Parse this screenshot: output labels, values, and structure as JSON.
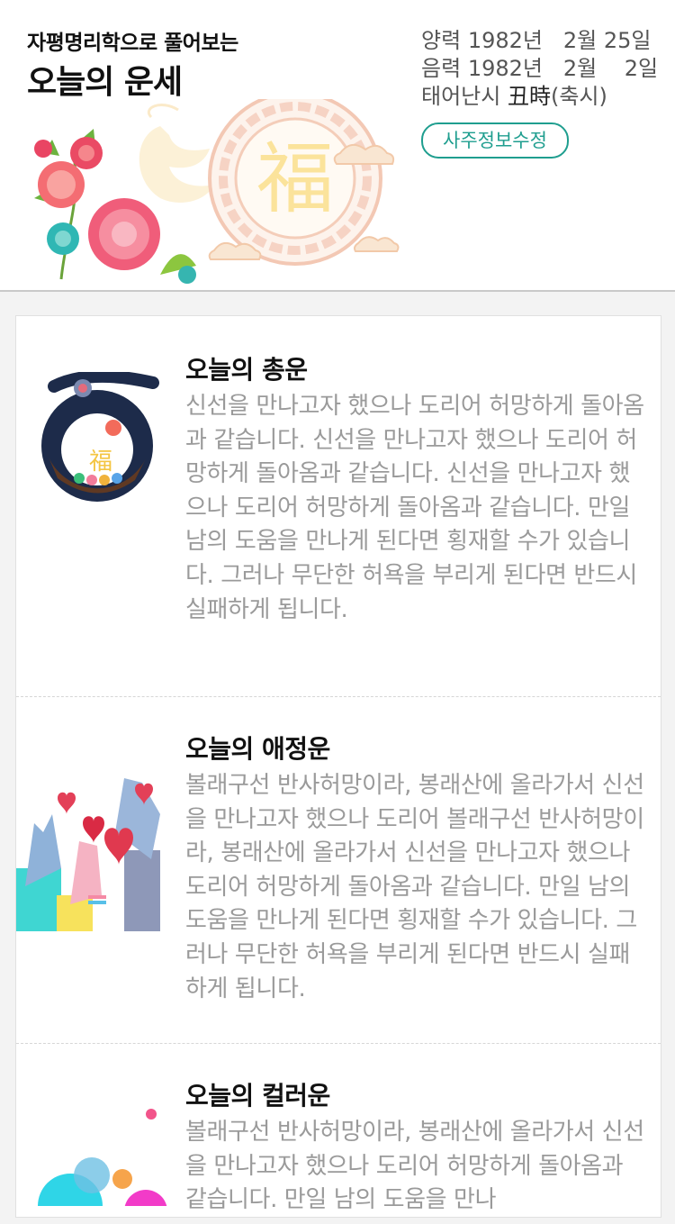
{
  "header": {
    "subtitle": "자평명리학으로 풀어보는",
    "title": "오늘의 운세",
    "solar": {
      "label": "양력",
      "year": "1982년",
      "month": "2월",
      "day": "25일"
    },
    "lunar": {
      "label": "음력",
      "year": "1982년",
      "month": "2월",
      "day": "2일"
    },
    "birth_time": {
      "label": "태어난시",
      "value": "丑時",
      "paren": "(축시)"
    },
    "edit_button": "사주정보수정",
    "banner_char": "福"
  },
  "sections": [
    {
      "title": "오늘의 총운",
      "icon_char": "福",
      "text": "신선을 만나고자 했으나 도리어 허망하게 돌아옴과 같습니다. 신선을 만나고자 했으나 도리어 허망하게 돌아옴과 같습니다. 신선을 만나고자 했으나 도리어 허망하게 돌아옴과 같습니다. 만일 남의 도움을 만나게 된다면 횡재할 수가 있습니다. 그러나 무단한 허욕을 부리게 된다면 반드시 실패하게 됩니다."
    },
    {
      "title": "오늘의 애정운",
      "text": "볼래구선 반사허망이라, 봉래산에 올라가서 신선을 만나고자 했으나 도리어 볼래구선 반사허망이라, 봉래산에 올라가서 신선을 만나고자 했으나 도리어 허망하게 돌아옴과 같습니다. 만일 남의 도움을 만나게 된다면 횡재할 수가 있습니다. 그러나 무단한 허욕을 부리게 된다면 반드시 실패하게 됩니다."
    },
    {
      "title": "오늘의 컬러운",
      "text": "볼래구선 반사허망이라, 봉래산에 올라가서 신선을 만나고자 했으나 도리어 허망하게 돌아옴과 같습니다. 만일 남의 도움을 만나"
    }
  ],
  "colors": {
    "accent": "#1f9e8f",
    "title_text": "#111111",
    "body_text": "#9a9a9a",
    "meta_text": "#555555"
  },
  "icons": [
    "peony-flower-icon",
    "fortune-seal-icon",
    "lucky-pouch-icon",
    "hearts-hands-icon",
    "color-dots-icon"
  ]
}
